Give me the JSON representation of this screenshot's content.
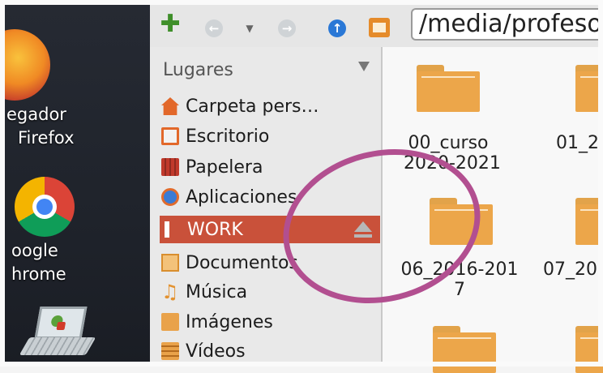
{
  "desktop": {
    "icons": [
      {
        "name": "firefox",
        "label_line1": "egador",
        "label_line2": "Firefox"
      },
      {
        "name": "chrome",
        "label_line1": "oogle",
        "label_line2": "hrome"
      }
    ]
  },
  "toolbar": {
    "buttons": [
      "add-icon",
      "back-icon",
      "history-dropdown-icon",
      "forward-icon",
      "up-icon",
      "home-icon"
    ],
    "path": "/media/profesor/"
  },
  "sidebar": {
    "header": "Lugares",
    "items": [
      {
        "label": "Carpeta pers…",
        "icon": "home-icon",
        "selected": false
      },
      {
        "label": "Escritorio",
        "icon": "desktop-icon",
        "selected": false
      },
      {
        "label": "Papelera",
        "icon": "trash-icon",
        "selected": false
      },
      {
        "label": "Aplicaciones",
        "icon": "applications-icon",
        "selected": false
      },
      {
        "label": "WORK",
        "icon": "usb-drive-icon",
        "selected": true
      },
      {
        "label": "Documentos",
        "icon": "documents-icon",
        "selected": false
      },
      {
        "label": "Música",
        "icon": "music-icon",
        "selected": false
      },
      {
        "label": "Imágenes",
        "icon": "images-icon",
        "selected": false
      },
      {
        "label": "Vídeos",
        "icon": "videos-icon",
        "selected": false
      }
    ]
  },
  "folders": [
    {
      "line1": "00_curso",
      "line2": "2020-2021"
    },
    {
      "line1": "01_2",
      "line2": ""
    },
    {
      "line1": "06_2016-201",
      "line2": "7"
    },
    {
      "line1": "07_20",
      "line2": ""
    },
    {
      "line1": "",
      "line2": ""
    },
    {
      "line1": "",
      "line2": ""
    }
  ],
  "colors": {
    "selected_row": "#c9513a",
    "folder": "#eca64a",
    "annotation_circle": "#b24f90"
  }
}
